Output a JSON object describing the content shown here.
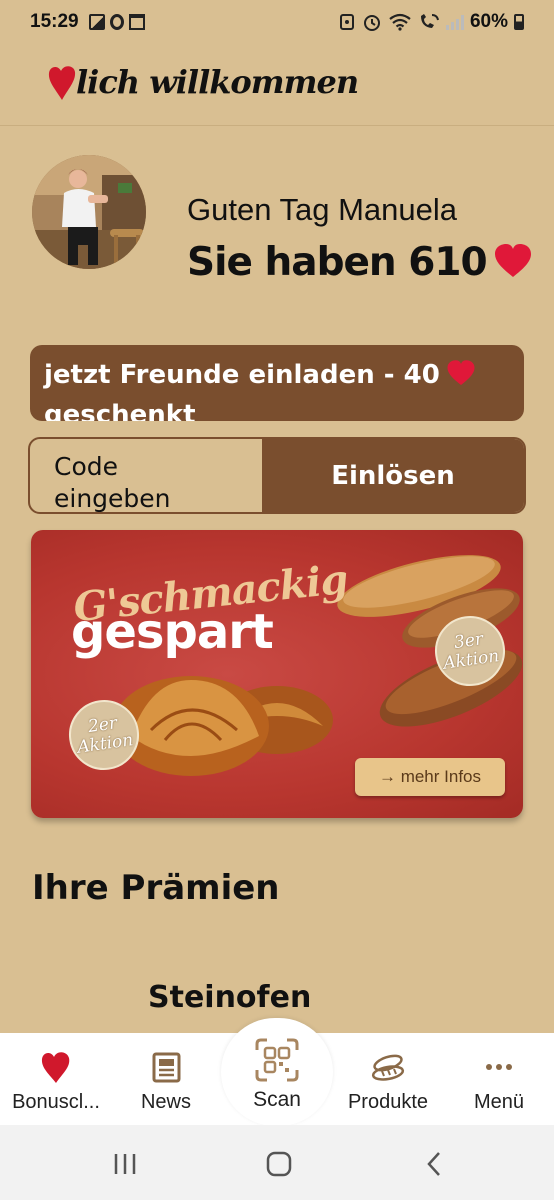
{
  "status_bar": {
    "time": "15:29",
    "battery": "60%"
  },
  "header": {
    "logo_text": "lich willkommen"
  },
  "greeting": {
    "line1": "Guten Tag Manuela",
    "line2": "Sie haben 610"
  },
  "invite_banner": {
    "text": "jetzt Freunde einladen - 40"
  },
  "code_row": {
    "input_placeholder": "Code eingeben",
    "redeem_label": "Einlösen"
  },
  "promo_banner": {
    "title_script": "G'schmackig",
    "title_main": "gespart",
    "badge_left_line1": "2er",
    "badge_left_line2": "Aktion",
    "badge_right_line1": "3er",
    "badge_right_line2": "Aktion",
    "button_label": "→ mehr Infos"
  },
  "rewards": {
    "section_title": "Ihre Prämien",
    "first_item": "Steinofen"
  },
  "bottom_nav": {
    "items": [
      {
        "label": "Bonuscl...",
        "icon": "heart-icon"
      },
      {
        "label": "News",
        "icon": "newspaper-icon"
      },
      {
        "label": "Scan",
        "icon": "qr-scan-icon"
      },
      {
        "label": "Produkte",
        "icon": "bread-icon"
      },
      {
        "label": "Menü",
        "icon": "more-dots-icon"
      }
    ]
  },
  "colors": {
    "background": "#d9bf92",
    "accent_brown": "#7a4e2e",
    "heart_red": "#d0182c",
    "promo_red": "#b8362f"
  }
}
